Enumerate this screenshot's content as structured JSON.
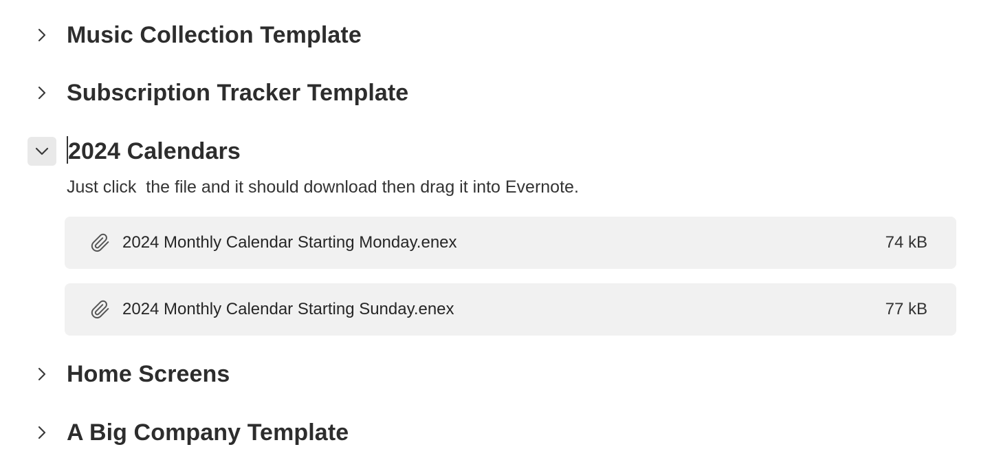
{
  "sections": [
    {
      "title": "Music Collection Template",
      "expanded": false
    },
    {
      "title": "Subscription Tracker Template",
      "expanded": false
    },
    {
      "title": "2024 Calendars",
      "expanded": true
    },
    {
      "title": "Home Screens",
      "expanded": false
    },
    {
      "title": "A Big Company Template",
      "expanded": false
    }
  ],
  "calendars": {
    "description": "Just click  the file and it should download then drag it into Evernote.",
    "attachments": [
      {
        "name": "2024 Monthly Calendar Starting Monday.enex",
        "size": "74 kB",
        "icon": "paperclip-icon"
      },
      {
        "name": "2024 Monthly Calendar Starting Sunday.enex",
        "size": "77 kB",
        "icon": "paperclip-icon"
      }
    ]
  },
  "icons": {
    "collapsed": "chevron-right-icon",
    "expanded": "chevron-down-icon"
  }
}
